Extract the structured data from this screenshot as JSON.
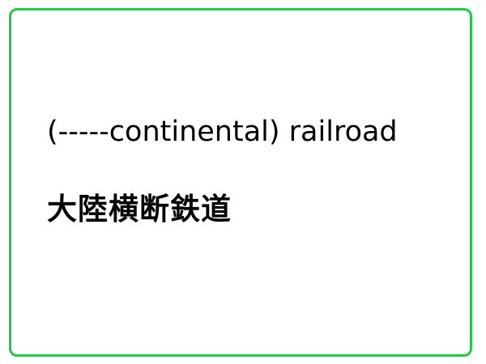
{
  "card": {
    "border_color": "#22c84a",
    "english_text": "(-----continental) railroad",
    "japanese_text": "大陸横断鉄道"
  }
}
